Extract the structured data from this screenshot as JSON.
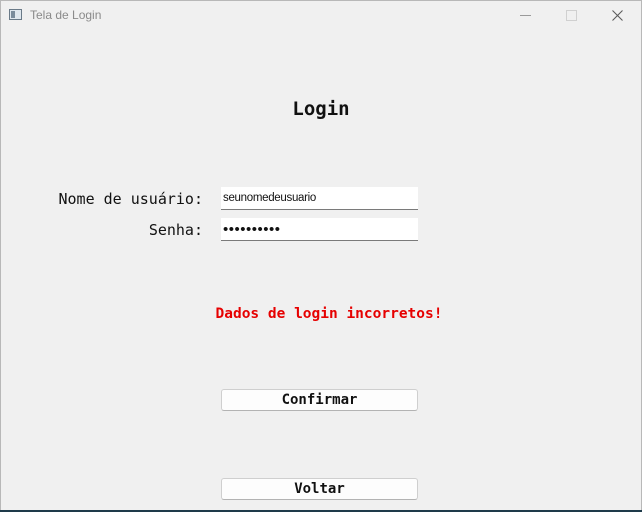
{
  "window": {
    "title": "Tela de Login",
    "icons": {
      "app": "app-window-icon",
      "minimize": "minimize-icon",
      "maximize": "maximize-icon",
      "close": "close-icon"
    }
  },
  "form": {
    "heading": "Login",
    "username_label": "Nome de usuário:",
    "username_value": "seunomedeusuario",
    "password_label": "Senha:",
    "password_value": "••••••••••",
    "error_message": "Dados de login incorretos!",
    "confirm_label": "Confirmar",
    "back_label": "Voltar"
  },
  "colors": {
    "error": "#e60000",
    "window_bg": "#f0f0f0"
  }
}
